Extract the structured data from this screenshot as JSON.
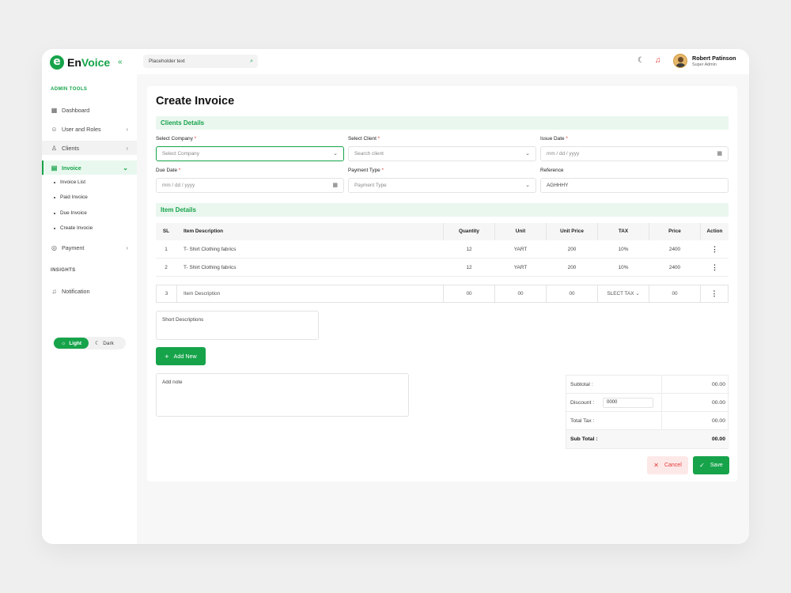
{
  "brand": {
    "mark": "e",
    "name_a": "En",
    "name_b": "Voice"
  },
  "sidebar": {
    "admin_label": "ADMIN TOOLS",
    "insights_label": "INSIGHTS",
    "items": [
      {
        "label": "Dashboard",
        "icon": "grid-icon"
      },
      {
        "label": "User and Roles",
        "icon": "users-icon"
      },
      {
        "label": "Clients",
        "icon": "user-icon"
      },
      {
        "label": "Invoice",
        "icon": "invoice-icon"
      },
      {
        "label": "Payment",
        "icon": "payment-icon"
      },
      {
        "label": "Notification",
        "icon": "bell-icon"
      }
    ],
    "invoice_sub": [
      "Invoice List",
      "Paid Invoice",
      "Due Invoice",
      "Create Invocie"
    ],
    "theme": {
      "light": "Light",
      "dark": "Dark"
    }
  },
  "topbar": {
    "search_placeholder": "Placeholder text",
    "user_name": "Robert Patinson",
    "user_role": "Super Admin"
  },
  "page": {
    "title": "Create Invoice",
    "clients_section": "Clients Details",
    "items_section": "Item Details",
    "fields": {
      "company_label": "Select Company",
      "company_placeholder": "Select Company",
      "client_label": "Select Client",
      "client_placeholder": "Search client",
      "issue_label": "Issue Date",
      "issue_placeholder": "mm / dd / yyyy",
      "due_label": "Due Date",
      "due_placeholder": "mm / dd / yyyy",
      "payment_label": "Payment Type",
      "payment_placeholder": "Payment Type",
      "reference_label": "Reference",
      "reference_value": "AGHHHY",
      "required_mark": "*"
    },
    "table": {
      "headers": [
        "SL",
        "Item Description",
        "Quantity",
        "Unit",
        "Unit Price",
        "TAX",
        "Price",
        "Action"
      ],
      "rows": [
        [
          "1",
          "T- Shirt Clothing fabrics",
          "12",
          "YART",
          "200",
          "10%",
          "2400"
        ],
        [
          "2",
          "T- Shirt Clothing fabrics",
          "12",
          "YART",
          "200",
          "10%",
          "2400"
        ]
      ],
      "entry_row": {
        "sl": "3",
        "desc": "Item Description",
        "qty": "00",
        "unit": "00",
        "unit_price": "00",
        "tax": "SLECT TAX",
        "price": "00"
      },
      "action_glyph": "⋮"
    },
    "short_desc_placeholder": "Short Descriptions",
    "add_new_label": "Add New",
    "add_note_placeholder": "Add note",
    "totals": {
      "subtotal_label": "Subtotal :",
      "subtotal_value": "00.00",
      "discount_label": "Discount :",
      "discount_input": "0000",
      "discount_value": "00.00",
      "tax_label": "Total Tax :",
      "tax_value": "00.00",
      "grand_label": "Sub Total :",
      "grand_value": "00.00"
    },
    "cancel_label": "Cancel",
    "save_label": "Save"
  },
  "colors": {
    "accent": "#16a34a",
    "accent_light": "#eaf7ef",
    "danger": "#e53935",
    "danger_light": "#fde8e8"
  }
}
